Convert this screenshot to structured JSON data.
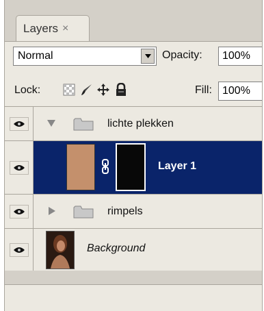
{
  "tab": {
    "label": "Layers",
    "close": "×"
  },
  "blend_mode": {
    "value": "Normal"
  },
  "opacity": {
    "label": "Opacity:",
    "value": "100%"
  },
  "lock": {
    "label": "Lock:",
    "icons": [
      "lock-transparent-pixels-icon",
      "lock-image-pixels-icon",
      "lock-position-icon",
      "lock-all-icon"
    ]
  },
  "fill": {
    "label": "Fill:",
    "value": "100%"
  },
  "layers": [
    {
      "name": "lichte plekken",
      "kind": "group",
      "expanded": true,
      "visible": true
    },
    {
      "name": "Layer 1",
      "kind": "layer",
      "selected": true,
      "visible": true,
      "has_mask": true,
      "thumb_color": "#c4906c"
    },
    {
      "name": "rimpels",
      "kind": "group",
      "expanded": false,
      "visible": true
    },
    {
      "name": "Background",
      "kind": "background",
      "visible": true
    }
  ],
  "colors": {
    "panel": "#d4d0c8",
    "row": "#ece9e1",
    "selection": "#0a246a"
  }
}
